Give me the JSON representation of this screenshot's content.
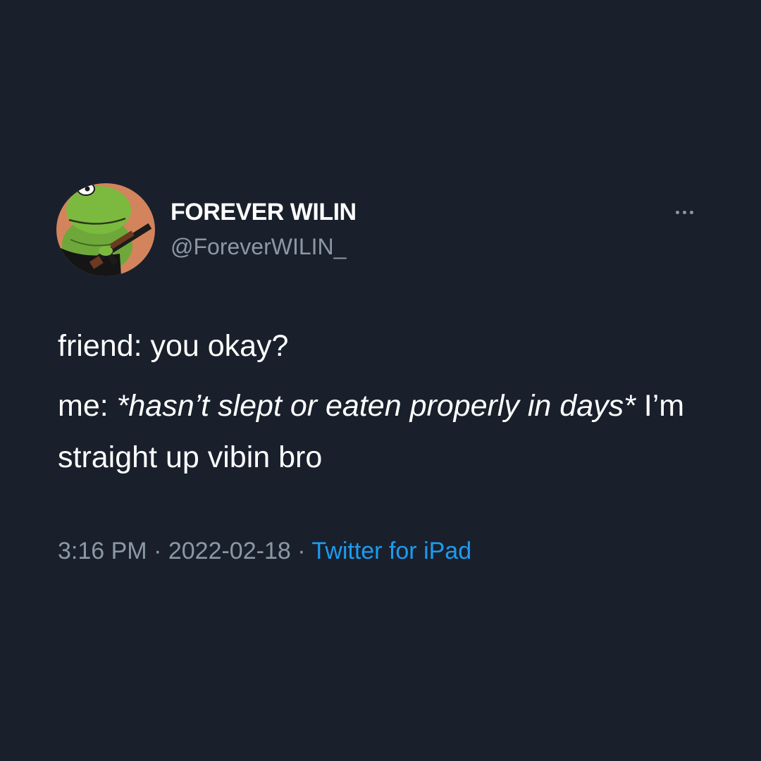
{
  "user": {
    "display_name": "FOREVER WILIN",
    "handle": "@ForeverWILIN_"
  },
  "tweet": {
    "line1": "friend: you okay?",
    "line2_prefix": "me: ",
    "line2_italic": "*hasn’t slept or eaten properly in days*",
    "line2_suffix": " I’m straight up vibin bro"
  },
  "meta": {
    "time": "3:16 PM",
    "separator": " · ",
    "date": "2022-02-18",
    "source": "Twitter for iPad"
  },
  "icons": {
    "more": "more-horizontal-icon",
    "avatar": "frog-avatar"
  },
  "colors": {
    "background": "#19202c",
    "text_primary": "#ffffff",
    "text_secondary": "#8b98a5",
    "link": "#1d9bf0"
  }
}
